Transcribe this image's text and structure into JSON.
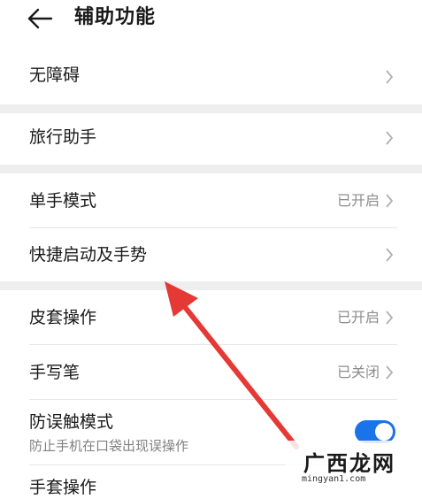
{
  "header": {
    "title": "辅助功能"
  },
  "rows": {
    "accessibility": {
      "label": "无障碍"
    },
    "travel_assistant": {
      "label": "旅行助手"
    },
    "one_hand_mode": {
      "label": "单手模式",
      "status": "已开启"
    },
    "quick_launch": {
      "label": "快捷启动及手势"
    },
    "cover_operation": {
      "label": "皮套操作",
      "status": "已开启"
    },
    "stylus": {
      "label": "手写笔",
      "status": "已关闭"
    },
    "mistouch": {
      "label": "防误触模式",
      "subtitle": "防止手机在口袋出现误操作",
      "toggle_on": true
    },
    "glove": {
      "label": "手套操作"
    }
  },
  "watermark": {
    "title": "广西龙网",
    "url": "mingyan1.com"
  },
  "colors": {
    "accent": "#1a73e8",
    "arrow": "#e53935",
    "separator": "#eeeeee"
  }
}
